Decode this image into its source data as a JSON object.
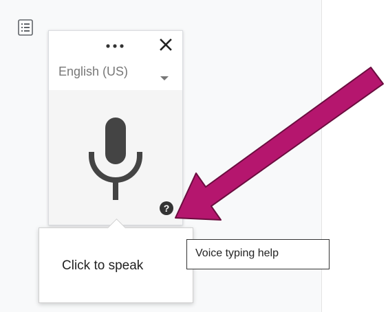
{
  "voice_typing": {
    "language_label": "English (US)",
    "speak_label": "Click to speak",
    "help_tooltip": "Voice typing help"
  },
  "icons": {
    "outline": "document-outline-icon",
    "more": "more-options-icon",
    "close": "close-icon",
    "dropdown": "chevron-down-icon",
    "microphone": "microphone-icon",
    "help": "help-icon",
    "annotation": "annotation-arrow"
  },
  "colors": {
    "panel_background": "#f8f9fa",
    "mic_area_background": "#f5f5f5",
    "icon_dark": "#444444",
    "arrow_fill": "#b5166e",
    "arrow_stroke": "#6b0d3f"
  }
}
